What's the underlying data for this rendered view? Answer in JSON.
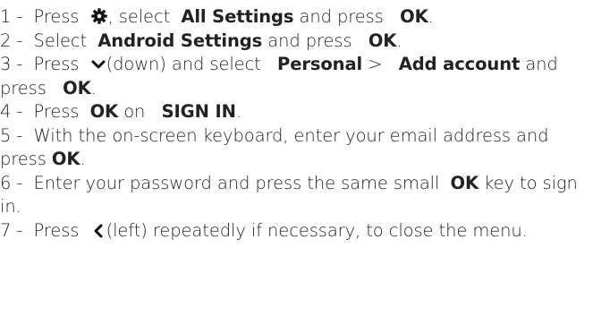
{
  "steps": [
    {
      "num": "1 -",
      "parts": [
        {
          "t": "Press",
          "b": false
        },
        {
          "icon": "gear-icon"
        },
        {
          "t": ", select",
          "b": false
        },
        {
          "t": "All Settings",
          "b": true
        },
        {
          "t": "and press",
          "b": false
        },
        {
          "t": "OK",
          "b": true
        },
        {
          "t": ".",
          "b": false
        }
      ]
    },
    {
      "num": "2 -",
      "parts": [
        {
          "t": "Select",
          "b": false
        },
        {
          "t": "Android Settings",
          "b": true
        },
        {
          "t": "and press",
          "b": false
        },
        {
          "t": "OK",
          "b": true
        },
        {
          "t": ".",
          "b": false
        }
      ]
    },
    {
      "num": "3 -",
      "parts": [
        {
          "t": "Press",
          "b": false
        },
        {
          "icon": "chevron-down-icon"
        },
        {
          "t": "(down) and select",
          "b": false
        },
        {
          "t": "Personal",
          "b": true
        },
        {
          "t": ">",
          "b": false
        },
        {
          "t": "Add account",
          "b": true
        },
        {
          "t": "and press",
          "b": false
        },
        {
          "t": "OK",
          "b": true
        },
        {
          "t": ".",
          "b": false
        }
      ]
    },
    {
      "num": "4 -",
      "parts": [
        {
          "t": "Press",
          "b": false
        },
        {
          "t": "OK",
          "b": true
        },
        {
          "t": "on",
          "b": false
        },
        {
          "t": "SIGN IN",
          "b": true
        },
        {
          "t": ".",
          "b": false
        }
      ]
    },
    {
      "num": "5 -",
      "parts": [
        {
          "t": "With the on-screen keyboard, enter your email address and press",
          "b": false
        },
        {
          "t": "OK",
          "b": true
        },
        {
          "t": ".",
          "b": false
        }
      ]
    },
    {
      "num": "6 -",
      "parts": [
        {
          "t": "Enter your password and press the same small",
          "b": false
        },
        {
          "t": "OK",
          "b": true
        },
        {
          "t": "key to sign in.",
          "b": false
        }
      ]
    },
    {
      "num": "7 -",
      "parts": [
        {
          "t": "Press",
          "b": false
        },
        {
          "icon": "chevron-left-icon"
        },
        {
          "t": "(left) repeatedly if necessary, to close the menu.",
          "b": false
        }
      ]
    }
  ]
}
